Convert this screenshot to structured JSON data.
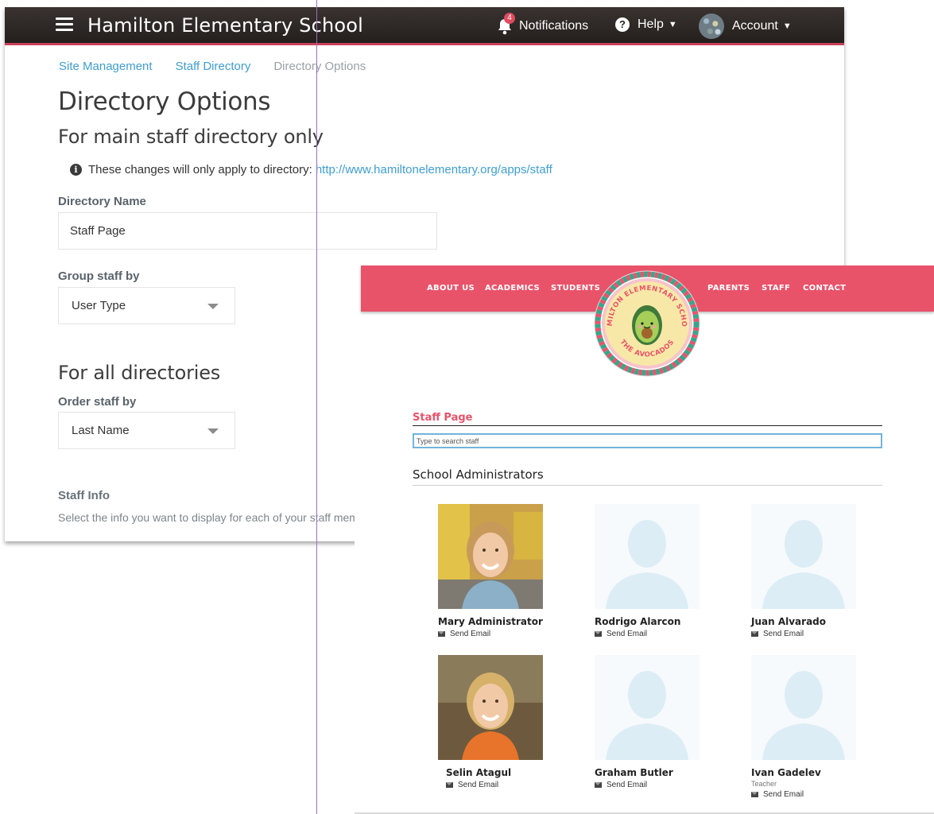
{
  "admin": {
    "header": {
      "site_title": "Hamilton Elementary School",
      "notifications_label": "Notifications",
      "notifications_count": "4",
      "help_label": "Help",
      "account_label": "Account"
    },
    "breadcrumb": {
      "items": [
        "Site Management",
        "Staff Directory",
        "Directory Options"
      ]
    },
    "page_title": "Directory Options",
    "section_main": "For main staff directory only",
    "info": {
      "text": "These changes will only apply to directory:",
      "url": "http://www.hamiltonelementary.org/apps/staff"
    },
    "directory_name": {
      "label": "Directory Name",
      "value": "Staff Page"
    },
    "group_by": {
      "label": "Group staff by",
      "value": "User Type"
    },
    "section_all": "For all directories",
    "order_by": {
      "label": "Order staff by",
      "value": "Last Name"
    },
    "staff_info": {
      "label": "Staff Info",
      "description": "Select the info you want to display for each of your staff members"
    }
  },
  "site": {
    "nav": {
      "left": [
        "ABOUT US",
        "ACADEMICS",
        "STUDENTS"
      ],
      "right": [
        "PARENTS",
        "STAFF",
        "CONTACT"
      ]
    },
    "logo": {
      "top_text": "HAMILTON ELEMENTARY SCHOOL",
      "bottom_text": "THE AVOCADOS"
    },
    "page_heading": "Staff Page",
    "search_placeholder": "Type to search staff",
    "group_title": "School Administrators",
    "send_email_label": "Send Email",
    "staff": [
      {
        "name": "Mary Administrator",
        "title": "",
        "photo": "photo"
      },
      {
        "name": "Rodrigo Alarcon",
        "title": "",
        "photo": "placeholder"
      },
      {
        "name": "Juan Alvarado",
        "title": "",
        "photo": "placeholder"
      },
      {
        "name": "Selin Atagul",
        "title": "",
        "photo": "photo"
      },
      {
        "name": "Graham Butler",
        "title": "",
        "photo": "placeholder"
      },
      {
        "name": "Ivan Gadelev",
        "title": "Teacher",
        "photo": "placeholder"
      }
    ]
  },
  "colors": {
    "brand_pink": "#e8536a",
    "link_blue": "#3f9ed0",
    "header_dark": "#2a2422",
    "placeholder_avatar": "#dcedf6"
  },
  "icons": [
    "hamburger-menu-icon",
    "bell-icon",
    "question-circle-icon",
    "info-circle-icon",
    "chevron-down-icon",
    "envelope-icon"
  ]
}
